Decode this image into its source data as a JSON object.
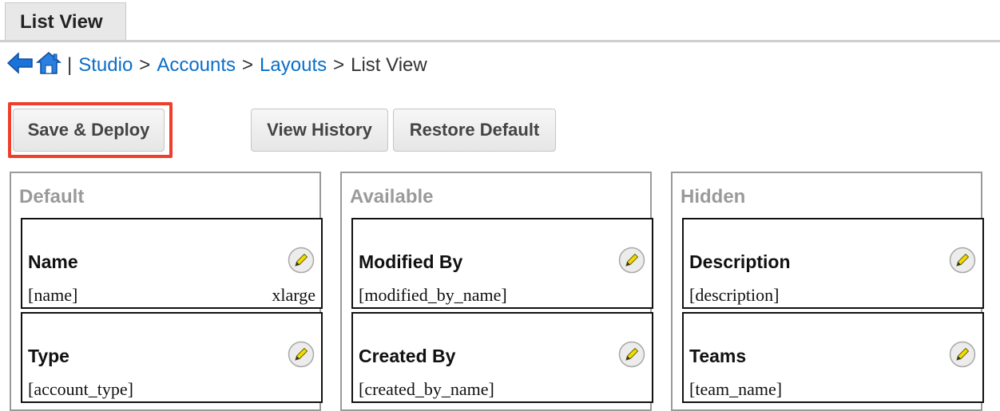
{
  "tab": {
    "label": "List View"
  },
  "breadcrumb": {
    "pipe": "|",
    "studio": "Studio",
    "sep": ">",
    "accounts": "Accounts",
    "layouts": "Layouts",
    "current": "List View"
  },
  "toolbar": {
    "save_deploy": "Save & Deploy",
    "view_history": "View History",
    "restore_default": "Restore Default"
  },
  "columns": [
    {
      "title": "Default",
      "fields": [
        {
          "label": "Name",
          "key": "[name]",
          "width": "xlarge"
        },
        {
          "label": "Type",
          "key": "[account_type]",
          "width": ""
        }
      ]
    },
    {
      "title": "Available",
      "fields": [
        {
          "label": "Modified By",
          "key": "[modified_by_name]",
          "width": ""
        },
        {
          "label": "Created By",
          "key": "[created_by_name]",
          "width": ""
        }
      ]
    },
    {
      "title": "Hidden",
      "fields": [
        {
          "label": "Description",
          "key": "[description]",
          "width": ""
        },
        {
          "label": "Teams",
          "key": "[team_name]",
          "width": ""
        }
      ]
    }
  ],
  "colors": {
    "accent": "#0b6ec8",
    "highlight": "#ee3e2c",
    "column_title": "#9a9a9a"
  },
  "icons": {
    "back": "back-arrow-icon",
    "home": "home-icon",
    "edit": "pencil-icon"
  }
}
